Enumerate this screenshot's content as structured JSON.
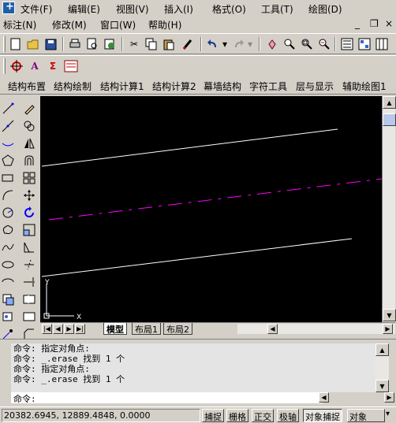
{
  "menu1": {
    "items": [
      "文件(F)",
      "编辑(E)",
      "视图(V)",
      "插入(I)",
      "格式(O)",
      "工具(T)",
      "绘图(D)"
    ]
  },
  "menu2": {
    "items": [
      "标注(N)",
      "修改(M)",
      "窗口(W)",
      "帮助(H)"
    ],
    "window_controls": [
      "_",
      "❐",
      "×"
    ]
  },
  "custom_toolbar": {
    "items": [
      "结构布置",
      "结构绘制",
      "结构计算1",
      "结构计算2",
      "幕墙结构",
      "字符工具",
      "层与显示",
      "辅助绘图1"
    ]
  },
  "tabs": {
    "items": [
      "模型",
      "布局1",
      "布局2"
    ],
    "active": "模型"
  },
  "ucs": {
    "y_label": "Y",
    "x_label": "X"
  },
  "command": {
    "history": [
      "命令: 指定对角点:",
      "命令: _.erase 找到 1 个",
      "命令: 指定对角点:",
      "命令: _.erase 找到 1 个"
    ],
    "prompt": "命令:"
  },
  "status": {
    "coordinates": "20382.6945, 12889.4848, 0.0000",
    "buttons": [
      "捕捉",
      "栅格",
      "正交",
      "极轴",
      "对象捕捉",
      "对象"
    ]
  },
  "colors": {
    "canvas_bg": "#000000",
    "line_white": "#ffffff",
    "line_magenta": "#ff00ff"
  }
}
